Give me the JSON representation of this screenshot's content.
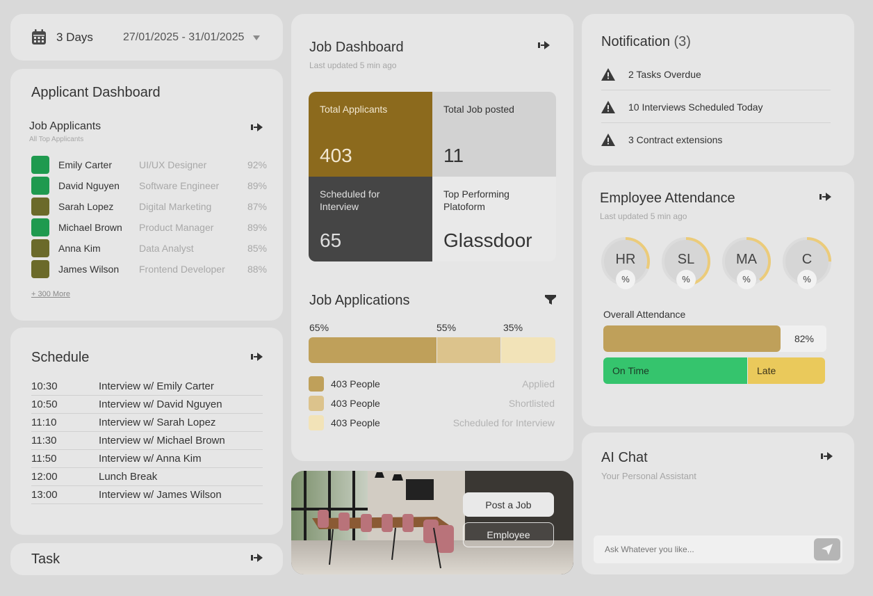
{
  "date_filter": {
    "range_label": "3 Days",
    "dates": "27/01/2025 - 31/01/2025"
  },
  "applicant_dashboard": {
    "title": "Applicant Dashboard",
    "section_title": "Job Applicants",
    "section_sub": "All Top Applicants",
    "applicants": [
      {
        "name": "Emily Carter",
        "role": "UI/UX Designer",
        "score": "92%",
        "color": "#1f9a4f"
      },
      {
        "name": "David Nguyen",
        "role": "Software Engineer",
        "score": "89%",
        "color": "#1f9a4f"
      },
      {
        "name": "Sarah Lopez",
        "role": "Digital Marketing",
        "score": "87%",
        "color": "#6b6a2a"
      },
      {
        "name": "Michael Brown",
        "role": "Product Manager",
        "score": "89%",
        "color": "#1f9a4f"
      },
      {
        "name": "Anna Kim",
        "role": "Data Analyst",
        "score": "85%",
        "color": "#6b6a2a"
      },
      {
        "name": "James Wilson",
        "role": "Frontend Developer",
        "score": "88%",
        "color": "#6b6a2a"
      }
    ],
    "more_link": "+ 300 More"
  },
  "schedule": {
    "title": "Schedule",
    "items": [
      {
        "time": "10:30",
        "desc": "Interview w/ Emily Carter"
      },
      {
        "time": "10:50",
        "desc": "Interview w/ David Nguyen"
      },
      {
        "time": "11:10",
        "desc": "Interview w/ Sarah Lopez"
      },
      {
        "time": "11:30",
        "desc": "Interview w/ Michael Brown"
      },
      {
        "time": "11:50",
        "desc": "Interview w/ Anna Kim"
      },
      {
        "time": "12:00",
        "desc": "Lunch Break"
      },
      {
        "time": "13:00",
        "desc": "Interview w/ James Wilson"
      }
    ]
  },
  "task": {
    "title": "Task"
  },
  "job_dashboard": {
    "title": "Job Dashboard",
    "updated": "Last updated 5 min ago",
    "tiles": {
      "total_applicants": {
        "label": "Total Applicants",
        "value": "403"
      },
      "total_jobs": {
        "label": "Total Job posted",
        "value": "11"
      },
      "scheduled": {
        "label": "Scheduled for Interview",
        "value": "65"
      },
      "top_platform": {
        "label": "Top Performing Platoform",
        "value": "Glassdoor"
      }
    }
  },
  "job_applications": {
    "title": "Job Applications",
    "bars": [
      {
        "pct": "65%",
        "color": "#bfa05a"
      },
      {
        "pct": "55%",
        "color": "#dcc38c"
      },
      {
        "pct": "35%",
        "color": "#f2e3b8"
      }
    ],
    "legend": [
      {
        "count": "403 People",
        "status": "Applied",
        "color": "#bfa05a"
      },
      {
        "count": "403 People",
        "status": "Shortlisted",
        "color": "#dcc38c"
      },
      {
        "count": "403 People",
        "status": "Scheduled for Interview",
        "color": "#f2e3b8"
      }
    ]
  },
  "photo_actions": {
    "post_job": "Post a Job",
    "employee": "Employee"
  },
  "notifications": {
    "title": "Notification",
    "count": "(3)",
    "items": [
      "2 Tasks Overdue",
      "10 Interviews Scheduled Today",
      "3 Contract extensions"
    ]
  },
  "attendance": {
    "title": "Employee Attendance",
    "updated": "Last updated 5 min ago",
    "gauges": [
      {
        "label": "HR",
        "pct": "%",
        "fill": 0.3
      },
      {
        "label": "SL",
        "pct": "%",
        "fill": 0.55
      },
      {
        "label": "MA",
        "pct": "%",
        "fill": 0.4
      },
      {
        "label": "C",
        "pct": "%",
        "fill": 0.25
      }
    ],
    "overall_label": "Overall Attendance",
    "overall_value": "82%",
    "overall_fraction": 0.82,
    "on_time": "On Time",
    "late": "Late",
    "colors": {
      "bar": "#bfa05a",
      "on_time": "#35c46d",
      "late": "#eac95b",
      "gauge": "#ebcb7a"
    }
  },
  "ai_chat": {
    "title": "AI Chat",
    "subtitle": "Your Personal Assistant",
    "placeholder": "Ask Whatever you like..."
  }
}
